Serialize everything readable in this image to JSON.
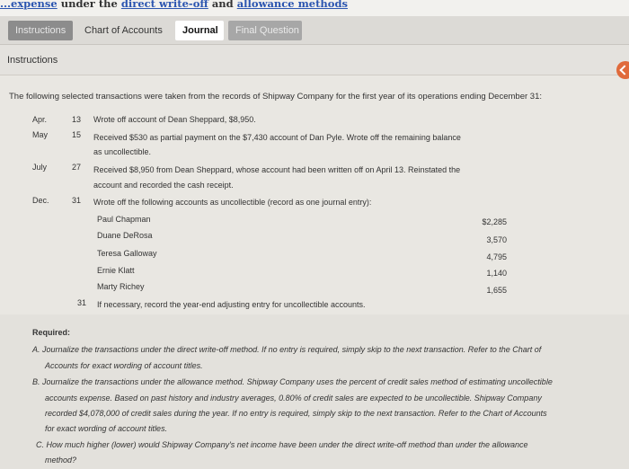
{
  "top_strip": {
    "link_text": "direct write-off",
    "joiner": "and",
    "link2_text": "allowance methods",
    "lead_text": "under the",
    "clipped_left": "...expense"
  },
  "tabs": {
    "instructions": "Instructions",
    "chart_of_accounts": "Chart of Accounts",
    "journal": "Journal",
    "final_question": "Final Question"
  },
  "section": {
    "title": "Instructions"
  },
  "intro": "The following selected transactions were taken from the records of Shipway Company for the first year of its operations ending December 31:",
  "transactions": [
    {
      "month": "Apr.",
      "day": "13",
      "lines": [
        "Wrote off account of Dean Sheppard, $8,950."
      ]
    },
    {
      "month": "May",
      "day": "15",
      "lines": [
        "Received $530 as partial payment on the $7,430 account of Dan Pyle. Wrote off the remaining balance",
        "as uncollectible."
      ]
    },
    {
      "month": "July",
      "day": "27",
      "lines": [
        "Received $8,950 from Dean Sheppard, whose account had been written off on April 13. Reinstated the",
        "account and recorded the cash receipt."
      ]
    },
    {
      "month": "Dec.",
      "day": "31",
      "lines": [
        "Wrote off the following accounts as uncollectible (record as one journal entry):"
      ]
    }
  ],
  "writeoffs": [
    {
      "name": "Paul Chapman",
      "amount": "$2,285"
    },
    {
      "name": "Duane DeRosa",
      "amount": "3,570"
    },
    {
      "name": "Teresa Galloway",
      "amount": "4,795"
    },
    {
      "name": "Ernie Klatt",
      "amount": "1,140"
    },
    {
      "name": "Marty Richey",
      "amount": "1,655"
    }
  ],
  "final_entry": {
    "day": "31",
    "text": "If necessary, record the year-end adjusting entry for uncollectible accounts."
  },
  "required": {
    "heading": "Required:",
    "a_lines": [
      "A. Journalize the transactions under the direct write-off method. If no entry is required, simply skip to the next transaction. Refer to the Chart of",
      "Accounts for exact wording of account titles."
    ],
    "b_lines": [
      "B. Journalize the transactions under the allowance method. Shipway Company uses the percent of credit sales method of estimating uncollectible",
      "accounts expense. Based on past history and industry averages, 0.80% of credit sales are expected to be uncollectible. Shipway Company",
      "recorded $4,078,000 of credit sales during the year. If no entry is required, simply skip to the next transaction. Refer to the Chart of Accounts",
      "for exact wording of account titles."
    ],
    "c_lines": [
      "C. How much higher (lower) would Shipway Company's net income have been under the direct write-off method than under the allowance",
      "method?"
    ]
  }
}
